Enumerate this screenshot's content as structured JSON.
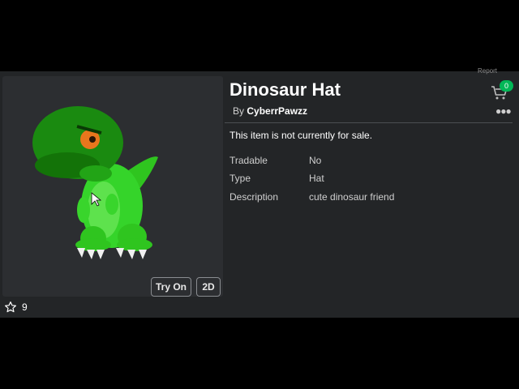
{
  "item": {
    "title": "Dinosaur Hat",
    "by_prefix": "By",
    "creator": "CyberrPawzz",
    "sale_status": "This item is not currently for sale.",
    "details": [
      {
        "label": "Tradable",
        "value": "No"
      },
      {
        "label": "Type",
        "value": "Hat"
      },
      {
        "label": "Description",
        "value": "cute dinosaur friend"
      }
    ]
  },
  "preview": {
    "try_on_label": "Try On",
    "view_2d_label": "2D"
  },
  "favorites": {
    "count": "9",
    "icon": "star-outline-icon"
  },
  "header": {
    "report_label": "Report",
    "cart_count": "0",
    "cart_icon": "cart-icon",
    "more_icon": "ellipsis-icon"
  },
  "colors": {
    "background": "#232527",
    "preview_bg": "#2c2e31",
    "accent_green": "#02b757"
  }
}
